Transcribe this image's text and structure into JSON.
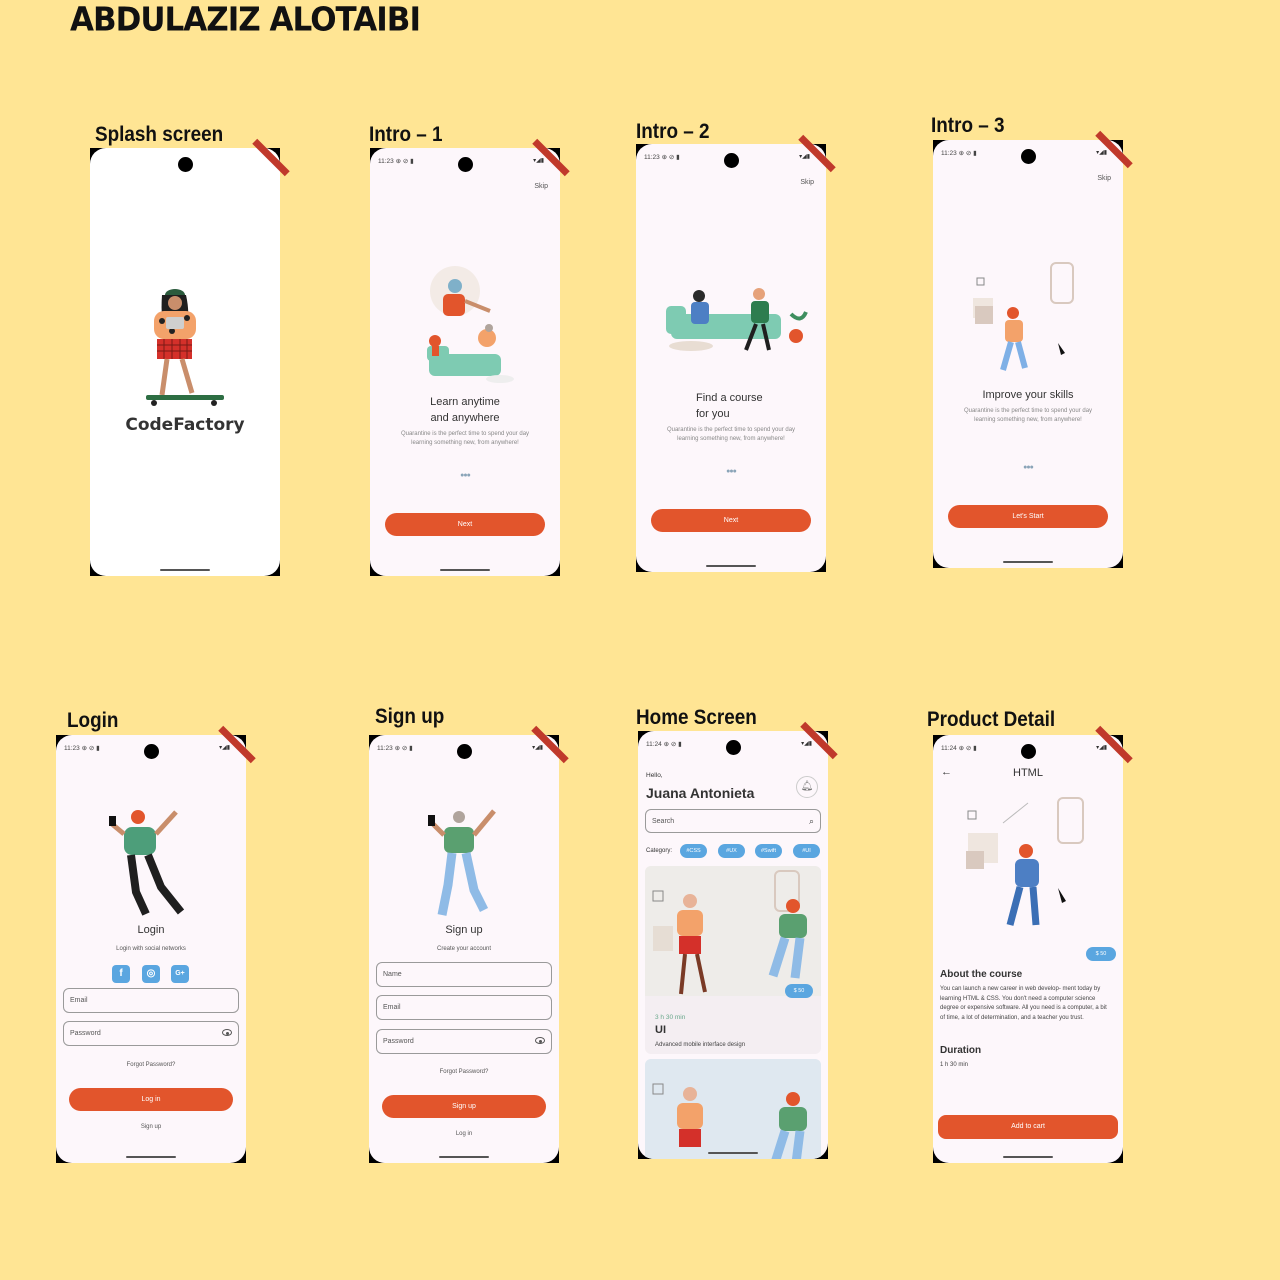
{
  "author": "ABDULAZIZ ALOTAIBI",
  "status": {
    "time_a": "11:23 ⊕ ⊘ ▮",
    "time_b": "11:24 ⊕ ⊘ ▮",
    "icons": "▾◢▮"
  },
  "labels": {
    "splash": "Splash screen",
    "intro1": "Intro – 1",
    "intro2": "Intro – 2",
    "intro3": "Intro – 3",
    "login": "Login",
    "signup": "Sign up",
    "home": "Home Screen",
    "detail": "Product Detail"
  },
  "splash": {
    "brand": "CodeFactory"
  },
  "intro1": {
    "skip": "Skip",
    "title_l1": "Learn anytime",
    "title_l2": "and anywhere",
    "sub": "Quarantine is the perfect time to spend your day learning something new, from anywhere!",
    "dots": "●●●",
    "button": "Next"
  },
  "intro2": {
    "skip": "Skip",
    "title_l1": "Find a course",
    "title_l2": "for you",
    "sub": "Quarantine is the perfect time to spend your day learning something new, from anywhere!",
    "dots": "●●●",
    "button": "Next"
  },
  "intro3": {
    "skip": "Skip",
    "title": "Improve your skills",
    "sub": "Quarantine is the perfect time to spend your day learning something new, from anywhere!",
    "dots": "●●●",
    "button": "Let's Start"
  },
  "login": {
    "title": "Login",
    "social_caption": "Login with social networks",
    "email_placeholder": "Email",
    "password_placeholder": "Password",
    "forgot": "Forgot Password?",
    "button": "Log in",
    "alt_link": "Sign up",
    "social_icons": [
      "facebook-icon",
      "instagram-icon",
      "google-plus-icon"
    ]
  },
  "signup": {
    "title": "Sign up",
    "caption": "Create your account",
    "name_placeholder": "Name",
    "email_placeholder": "Email",
    "password_placeholder": "Password",
    "forgot": "Forgot Password?",
    "button": "Sign up",
    "alt_link": "Log in"
  },
  "home": {
    "greeting": "Hello,",
    "user": "Juana Antonieta",
    "search_placeholder": "Search",
    "category_label": "Category:",
    "chips": [
      "#CSS",
      "#UX",
      "#Swift",
      "#UI"
    ],
    "card": {
      "price": "$ 50",
      "duration": "3 h 30 min",
      "title": "UI",
      "desc": "Advanced mobile interface design"
    }
  },
  "detail": {
    "title": "HTML",
    "price": "$ 50",
    "about_title": "About the course",
    "about_text": "You can launch a new career in web develop- ment today by learning HTML & CSS. You don't need a computer science degree or expensive software. All you need is a computer, a bit of time, a lot of determination, and a teacher you trust.",
    "duration_title": "Duration",
    "duration": "1 h 30 min",
    "button": "Add to cart"
  },
  "colors": {
    "background": "#ffe594",
    "accent": "#e2552c",
    "chip": "#5aa6e0"
  }
}
